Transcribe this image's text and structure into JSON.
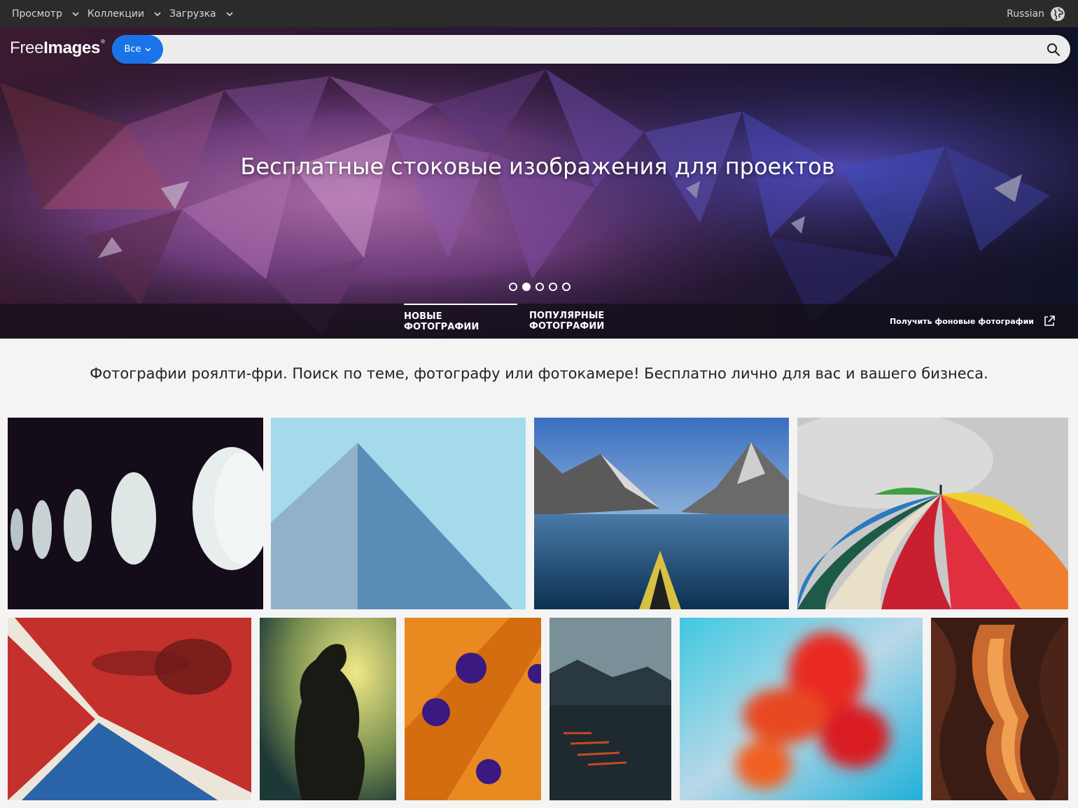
{
  "topnav": {
    "items": [
      {
        "label": "Просмотр"
      },
      {
        "label": "Коллекции"
      },
      {
        "label": "Загрузка"
      }
    ],
    "language": "Russian"
  },
  "header": {
    "logo_light": "Free",
    "logo_bold": "Images",
    "logo_mark": "®",
    "search": {
      "category": "Все",
      "value": "",
      "placeholder": ""
    }
  },
  "hero": {
    "title": "Бесплатные стоковые изображения для проектов",
    "slides_total": 5,
    "active_slide": 2,
    "tabs": [
      {
        "label": "НОВЫЕ ФОТОГРАФИИ",
        "active": true
      },
      {
        "label": "ПОПУЛЯРНЫЕ ФОТОГРАФИИ",
        "active": false
      }
    ],
    "bg_link": "Получить фоновые фотографии"
  },
  "tagline": "Фотографии роялти-фри. Поиск по теме, фотографу или фотокамере! Бесплатно лично для вас и вашего бизнеса.",
  "gallery": {
    "row1": [
      {
        "subject": "eggs-on-dark"
      },
      {
        "subject": "concrete-pyramid-sky"
      },
      {
        "subject": "mountain-lake-kayak"
      },
      {
        "subject": "rainbow-umbrella"
      }
    ],
    "row2": [
      {
        "subject": "red-blue-shadow-abstract"
      },
      {
        "subject": "silhouette-statue"
      },
      {
        "subject": "orange-tubes-purple-dots"
      },
      {
        "subject": "boats-on-lake"
      },
      {
        "subject": "blurred-red-flowers"
      },
      {
        "subject": "antelope-canyon"
      }
    ]
  },
  "colors": {
    "topbar": "#2b2b2b",
    "accent": "#1a73e8",
    "page_bg": "#f4f4f4"
  }
}
